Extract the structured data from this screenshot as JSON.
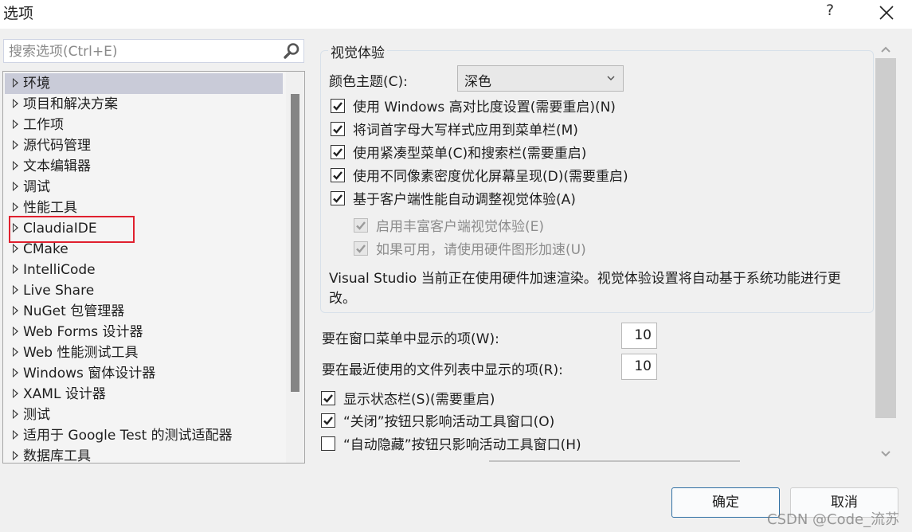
{
  "window": {
    "title": "选项",
    "help_label": "?",
    "close_icon": "close-icon"
  },
  "search": {
    "placeholder": "搜索选项(Ctrl+E)",
    "value": "",
    "icon": "search-icon"
  },
  "tree": {
    "items": [
      {
        "label": "环境",
        "selected": true
      },
      {
        "label": "项目和解决方案"
      },
      {
        "label": "工作项"
      },
      {
        "label": "源代码管理"
      },
      {
        "label": "文本编辑器"
      },
      {
        "label": "调试"
      },
      {
        "label": "性能工具"
      },
      {
        "label": "ClaudiaIDE",
        "highlighted": true
      },
      {
        "label": "CMake"
      },
      {
        "label": "IntelliCode"
      },
      {
        "label": "Live Share"
      },
      {
        "label": "NuGet 包管理器"
      },
      {
        "label": "Web Forms 设计器"
      },
      {
        "label": "Web 性能测试工具"
      },
      {
        "label": "Windows 窗体设计器"
      },
      {
        "label": "XAML 设计器"
      },
      {
        "label": "测试"
      },
      {
        "label": "适用于 Google Test 的测试适配器"
      },
      {
        "label": "数据库工具"
      }
    ],
    "highlight_color": "#e0202e",
    "selected_color": "#c9cbd8"
  },
  "visual_experience": {
    "group_title": "视觉体验",
    "color_theme_label": "颜色主题(C):",
    "color_theme_value": "深色",
    "checkboxes": [
      {
        "label": "使用 Windows 高对比度设置(需要重启)(N)",
        "checked": true,
        "enabled": true
      },
      {
        "label": "将词首字母大写样式应用到菜单栏(M)",
        "checked": true,
        "enabled": true
      },
      {
        "label": "使用紧凑型菜单(C)和搜索栏(需要重启)",
        "checked": true,
        "enabled": true
      },
      {
        "label": "使用不同像素密度优化屏幕呈现(D)(需要重启)",
        "checked": true,
        "enabled": true
      },
      {
        "label": "基于客户端性能自动调整视觉体验(A)",
        "checked": true,
        "enabled": true
      },
      {
        "label": "启用丰富客户端视觉体验(E)",
        "checked": true,
        "enabled": false
      },
      {
        "label": "如果可用，请使用硬件图形加速(U)",
        "checked": true,
        "enabled": false
      }
    ],
    "info_text": "Visual Studio 当前正在使用硬件加速渲染。视觉体验设置将自动基于系统功能进行更改。"
  },
  "window_menu_items": {
    "label": "要在窗口菜单中显示的项(W):",
    "value": "10"
  },
  "recent_files_items": {
    "label": "要在最近使用的文件列表中显示的项(R):",
    "value": "10"
  },
  "general_checkboxes": [
    {
      "label": "显示状态栏(S)(需要重启)",
      "checked": true
    },
    {
      "label": "“关闭”按钮只影响活动工具窗口(O)",
      "checked": true
    },
    {
      "label": "“自动隐藏”按钮只影响活动工具窗口(H)",
      "checked": false
    }
  ],
  "buttons": {
    "ok": "确定",
    "cancel": "取消"
  },
  "watermark": "CSDN @Code_流苏"
}
